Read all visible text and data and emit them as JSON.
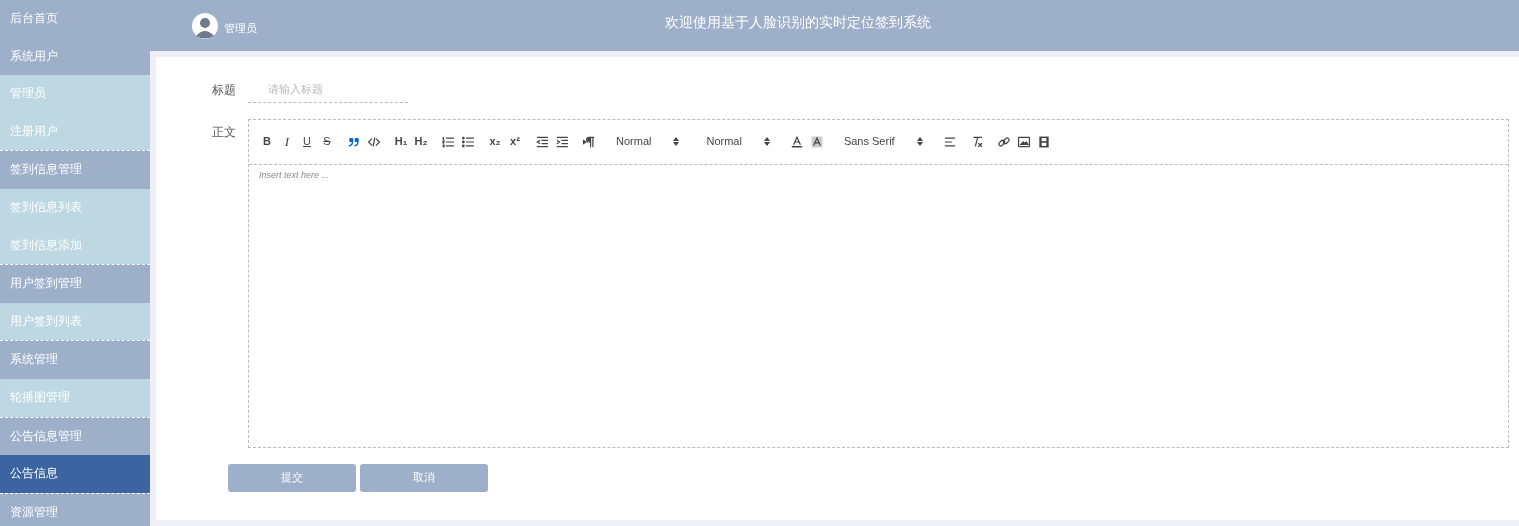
{
  "sidebar": {
    "items": [
      {
        "label": "后台首页",
        "kind": "link",
        "selected": false
      },
      {
        "label": "系统用户",
        "kind": "group",
        "selected": false,
        "children": [
          {
            "label": "管理员",
            "selected": false
          },
          {
            "label": "注册用户",
            "selected": false
          }
        ]
      },
      {
        "label": "签到信息管理",
        "kind": "group",
        "selected": false,
        "children": [
          {
            "label": "签到信息列表",
            "selected": false
          },
          {
            "label": "签到信息添加",
            "selected": false
          }
        ]
      },
      {
        "label": "用户签到管理",
        "kind": "group",
        "selected": false,
        "children": [
          {
            "label": "用户签到列表",
            "selected": false
          }
        ]
      },
      {
        "label": "系统管理",
        "kind": "group",
        "selected": false,
        "children": [
          {
            "label": "轮播图管理",
            "selected": false
          }
        ]
      },
      {
        "label": "公告信息管理",
        "kind": "group",
        "selected": false,
        "children": [
          {
            "label": "公告信息",
            "selected": true
          }
        ]
      },
      {
        "label": "资源管理",
        "kind": "group",
        "selected": false
      }
    ]
  },
  "header": {
    "user": "管理员",
    "title": "欢迎使用基于人脸识别的实时定位签到系统"
  },
  "form": {
    "title_label": "标题",
    "title_placeholder": "请输入标题",
    "body_label": "正文",
    "toolbar": [
      [
        {
          "kind": "bold",
          "label": "B",
          "active": false
        },
        {
          "kind": "italic",
          "label": "I",
          "active": false
        },
        {
          "kind": "underline",
          "label": "U",
          "active": false
        },
        {
          "kind": "strike",
          "label": "S",
          "active": false
        }
      ],
      [
        {
          "kind": "blockquote",
          "active": true
        },
        {
          "kind": "code",
          "active": false
        }
      ],
      [
        {
          "kind": "heading",
          "label": "H₁",
          "active": false
        },
        {
          "kind": "heading",
          "label": "H₂",
          "active": false
        }
      ],
      [
        {
          "kind": "ordered-list",
          "active": false
        },
        {
          "kind": "bullet-list",
          "active": false
        }
      ],
      [
        {
          "kind": "script",
          "label": "x₂",
          "active": false
        },
        {
          "kind": "script",
          "label": "x²",
          "active": false
        }
      ],
      [
        {
          "kind": "outdent",
          "active": false
        },
        {
          "kind": "indent",
          "active": false
        }
      ],
      [
        {
          "kind": "direction",
          "active": false
        }
      ],
      [
        {
          "kind": "picker",
          "label": "Normal"
        }
      ],
      [
        {
          "kind": "picker",
          "label": "Normal"
        }
      ],
      [
        {
          "kind": "color",
          "active": false
        },
        {
          "kind": "background",
          "active": false
        }
      ],
      [
        {
          "kind": "picker",
          "label": "Sans Serif"
        }
      ],
      [
        {
          "kind": "align",
          "active": false
        }
      ],
      [
        {
          "kind": "clean",
          "active": false
        }
      ],
      [
        {
          "kind": "link",
          "active": false
        },
        {
          "kind": "image",
          "active": false
        },
        {
          "kind": "video",
          "active": false
        }
      ]
    ],
    "editor_placeholder": "Insert text here ...",
    "buttons": [
      "提交",
      "取消"
    ]
  }
}
